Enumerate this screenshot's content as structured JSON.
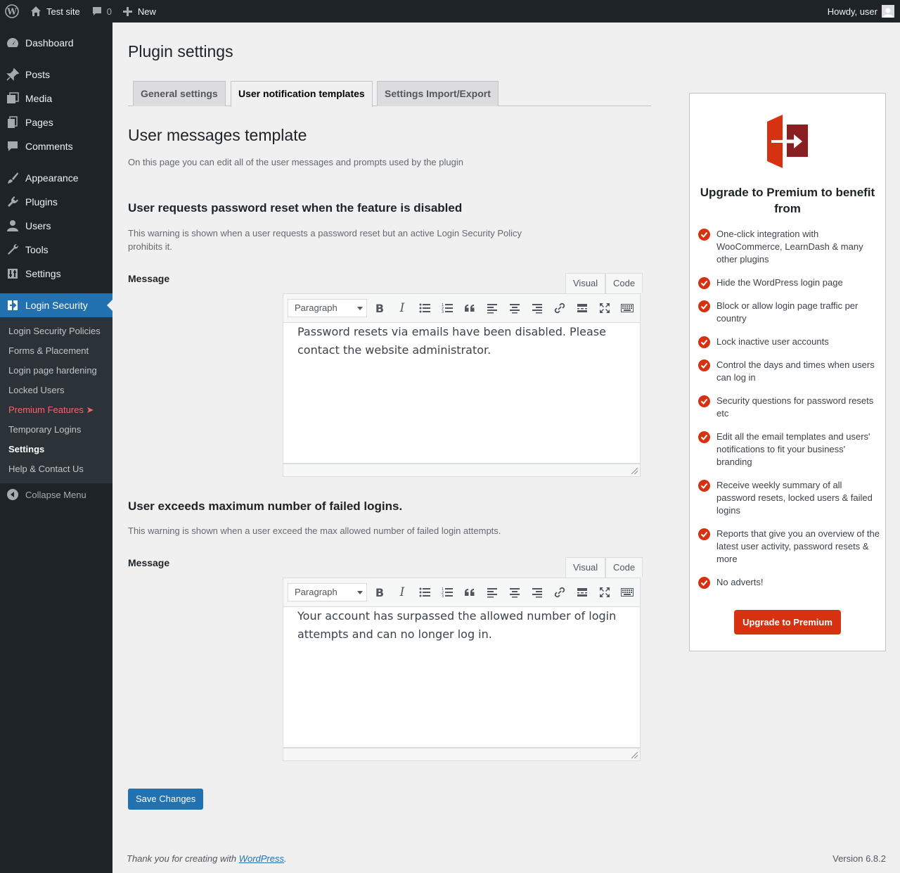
{
  "adminbar": {
    "site_name": "Test site",
    "comments_count": "0",
    "new_label": "New",
    "howdy": "Howdy, user"
  },
  "sidebar": {
    "items": [
      {
        "label": "Dashboard",
        "icon": "dashboard-icon"
      },
      {
        "label": "Posts",
        "icon": "pin-icon"
      },
      {
        "label": "Media",
        "icon": "media-icon"
      },
      {
        "label": "Pages",
        "icon": "pages-icon"
      },
      {
        "label": "Comments",
        "icon": "comment-icon"
      },
      {
        "label": "Appearance",
        "icon": "brush-icon"
      },
      {
        "label": "Plugins",
        "icon": "plug-icon"
      },
      {
        "label": "Users",
        "icon": "user-icon"
      },
      {
        "label": "Tools",
        "icon": "wrench-icon"
      },
      {
        "label": "Settings",
        "icon": "settings-icon"
      },
      {
        "label": "Login Security",
        "icon": "login-security-icon"
      }
    ],
    "submenu": [
      "Login Security Policies",
      "Forms & Placement",
      "Login page hardening",
      "Locked Users",
      "Premium Features ➤",
      "Temporary Logins",
      "Settings",
      "Help & Contact Us"
    ],
    "collapse_label": "Collapse Menu"
  },
  "page": {
    "title": "Plugin settings",
    "tabs": [
      "General settings",
      "User notification templates",
      "Settings Import/Export"
    ],
    "section_title": "User messages template",
    "section_desc": "On this page you can edit all of the user messages and prompts used by the plugin"
  },
  "blocks": [
    {
      "title": "User requests password reset when the feature is disabled",
      "desc": "This warning is shown when a user requests a password reset but an active Login Security Policy prohibits it.",
      "field_label": "Message",
      "content": "Password resets via emails have been disabled. Please contact the website administrator."
    },
    {
      "title": "User exceeds maximum number of failed logins.",
      "desc": "This warning is shown when a user exceed the max allowed number of failed login attempts.",
      "field_label": "Message",
      "content": "Your account has surpassed the allowed number of login attempts and can no longer log in."
    }
  ],
  "editor": {
    "visual_tab": "Visual",
    "code_tab": "Code",
    "format_select": "Paragraph"
  },
  "save_button": "Save Changes",
  "premium": {
    "title": "Upgrade to Premium to benefit from",
    "features": [
      "One-click integration with WooCommerce, LearnDash & many other plugins",
      "Hide the WordPress login page",
      "Block or allow login page traffic per country",
      "Lock inactive user accounts",
      "Control the days and times when users can log in",
      "Security questions for password resets etc",
      "Edit all the email templates and users' notifications to fit your business' branding",
      "Receive weekly summary of all password resets, locked users & failed logins",
      "Reports that give you an overview of the latest user activity, password resets & more",
      "No adverts!"
    ],
    "button": "Upgrade to Premium",
    "accent_color": "#d63111"
  },
  "footer": {
    "thanks_prefix": "Thank you for creating with ",
    "wp_link": "WordPress",
    "thanks_suffix": ".",
    "version": "Version 6.8.2"
  }
}
